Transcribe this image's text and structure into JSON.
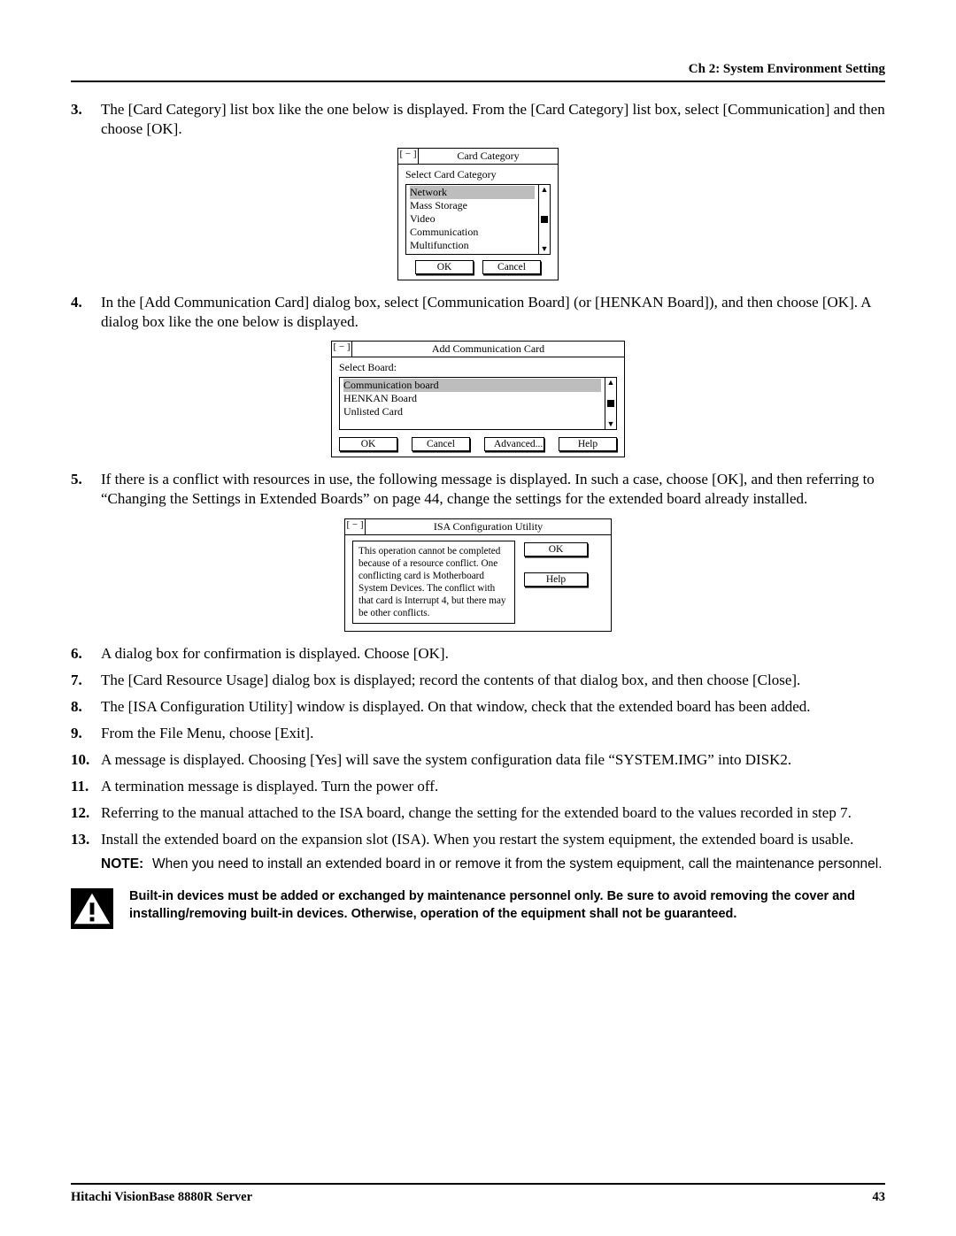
{
  "header": {
    "chapter": "Ch 2: System Environment Setting"
  },
  "steps": {
    "n3": {
      "num": "3.",
      "text": "The [Card Category] list box like the one below is displayed. From the [Card Category] list box, select [Communication] and then choose [OK]."
    },
    "n4": {
      "num": "4.",
      "text": "In the [Add Communication Card] dialog box, select [Communication Board] (or [HENKAN Board]), and then choose [OK]. A dialog box like the one below is displayed."
    },
    "n5": {
      "num": "5.",
      "text": "If there is a conflict with resources in use, the following message is displayed. In such a case, choose [OK], and then referring to “Changing the Settings in Extended Boards” on page 44, change the settings for the extended board already installed."
    },
    "n6": {
      "num": "6.",
      "text": "A dialog box for confirmation is displayed. Choose [OK]."
    },
    "n7": {
      "num": "7.",
      "text": "The [Card Resource Usage] dialog box is displayed; record the contents of that dialog box, and then choose [Close]."
    },
    "n8": {
      "num": "8.",
      "text": "The [ISA Configuration Utility] window is displayed. On that window, check that the extended board has been added."
    },
    "n9": {
      "num": "9.",
      "text": "From the File Menu, choose [Exit]."
    },
    "n10": {
      "num": "10.",
      "text": "A message is displayed. Choosing [Yes] will save the system configuration data file “SYSTEM.IMG” into DISK2."
    },
    "n11": {
      "num": "11.",
      "text": "A termination message is displayed. Turn the power off."
    },
    "n12": {
      "num": "12.",
      "text": "Referring to the manual attached to the ISA board, change the setting for the extended board to the values recorded in step 7."
    },
    "n13": {
      "num": "13.",
      "text": "Install the extended board on the expansion slot (ISA). When you restart the system equipment, the extended board is usable."
    }
  },
  "note": {
    "label": "NOTE:",
    "text": "When you need to install an extended board in or remove it from the system equipment, call the maintenance personnel."
  },
  "warning": {
    "text": "Built-in devices must be added or exchanged by maintenance personnel only. Be sure to avoid removing the cover and installing/removing built-in devices. Otherwise, operation of the equipment shall not be guaranteed."
  },
  "dlg1": {
    "close": "[ − ]",
    "title": "Card Category",
    "label": "Select Card Category",
    "items": [
      "Network",
      "Mass Storage",
      "Video",
      "Communication",
      "Multifunction"
    ],
    "ok": "OK",
    "cancel": "Cancel"
  },
  "dlg2": {
    "close": "[ − ]",
    "title": "Add Communication Card",
    "label": "Select Board:",
    "items": [
      "Communication board",
      "HENKAN Board",
      "Unlisted Card"
    ],
    "ok": "OK",
    "cancel": "Cancel",
    "advanced": "Advanced...",
    "help": "Help"
  },
  "dlg3": {
    "close": "[ − ]",
    "title": "ISA Configuration Utility",
    "msg": "This operation cannot be completed because of a resource conflict. One conflicting card is Motherboard System Devices. The conflict with that card is Interrupt 4, but there may be other conflicts.",
    "ok": "OK",
    "help": "Help"
  },
  "footer": {
    "left": "Hitachi VisionBase 8880R Server",
    "right": "43"
  }
}
